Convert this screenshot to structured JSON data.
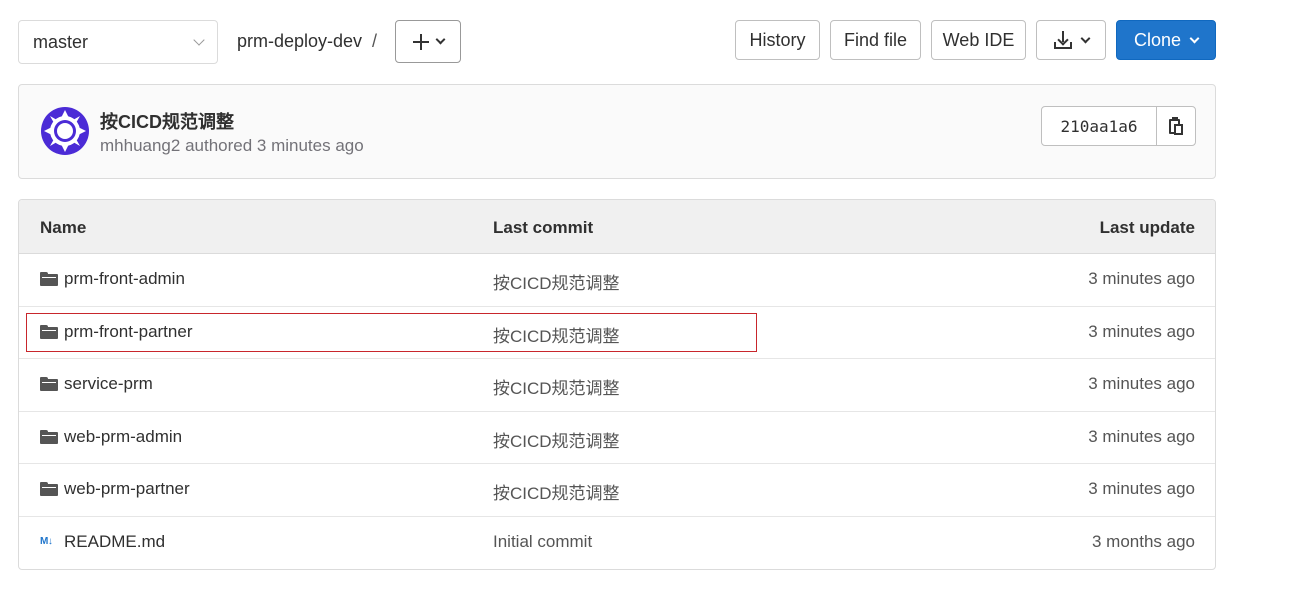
{
  "branch": {
    "selected": "master"
  },
  "breadcrumb": {
    "path": "prm-deploy-dev",
    "separator": "/"
  },
  "toolbar": {
    "history": "History",
    "find_file": "Find file",
    "web_ide": "Web IDE",
    "clone": "Clone"
  },
  "commit": {
    "title": "按CICD规范调整",
    "author": "mhhuang2",
    "meta": "mhhuang2 authored 3 minutes ago",
    "sha": "210aa1a6"
  },
  "table": {
    "headers": {
      "name": "Name",
      "last_commit": "Last commit",
      "last_update": "Last update"
    },
    "rows": [
      {
        "name": "prm-front-admin",
        "type": "folder",
        "commit": "按CICD规范调整",
        "updated": "3 minutes ago"
      },
      {
        "name": "prm-front-partner",
        "type": "folder",
        "commit": "按CICD规范调整",
        "updated": "3 minutes ago"
      },
      {
        "name": "service-prm",
        "type": "folder",
        "commit": "按CICD规范调整",
        "updated": "3 minutes ago"
      },
      {
        "name": "web-prm-admin",
        "type": "folder",
        "commit": "按CICD规范调整",
        "updated": "3 minutes ago"
      },
      {
        "name": "web-prm-partner",
        "type": "folder",
        "commit": "按CICD规范调整",
        "updated": "3 minutes ago"
      },
      {
        "name": "README.md",
        "type": "markdown",
        "commit": "Initial commit",
        "updated": "3 months ago"
      }
    ]
  },
  "icons": {
    "markdown_glyph": "M↓"
  },
  "colors": {
    "accent": "#1f75cb",
    "highlight_border": "#c8262c",
    "avatar": "#4b2bd6"
  }
}
